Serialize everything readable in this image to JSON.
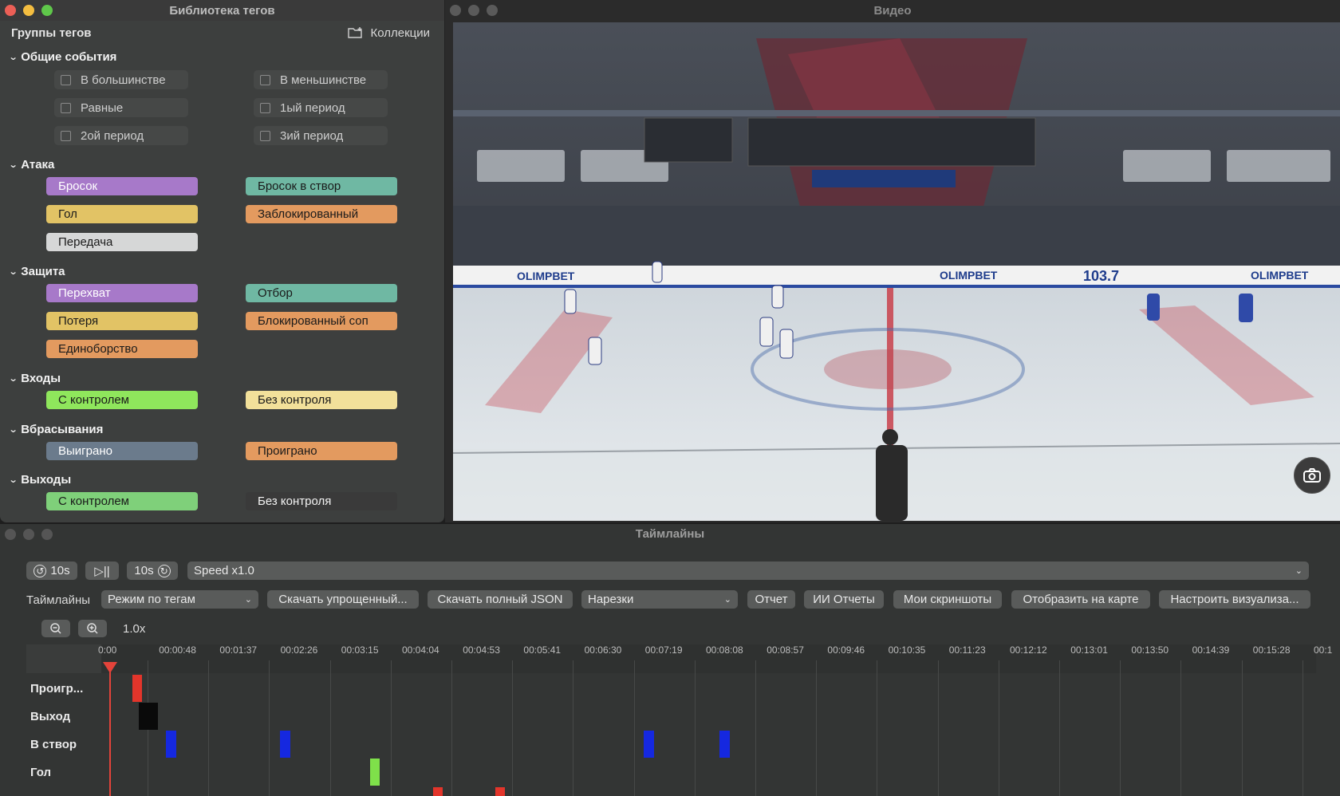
{
  "tag_library": {
    "window_title": "Библиотека тегов",
    "groups_label": "Группы тегов",
    "collections_label": "Коллекции",
    "sections": {
      "general": {
        "title": "Общие события",
        "checkboxes": [
          "В большинстве",
          "В меньшинстве",
          "Равные",
          "1ый период",
          "2ой период",
          "3ий период"
        ]
      },
      "attack": {
        "title": "Атака",
        "tags": [
          {
            "label": "Бросок",
            "color": "#a779c9"
          },
          {
            "label": "Бросок в створ",
            "color": "#6fb8a3"
          },
          {
            "label": "Гол",
            "color": "#e2c365"
          },
          {
            "label": "Заблокированный",
            "color": "#e39a5f"
          },
          {
            "label": "Передача",
            "color": "#d6d7d7"
          }
        ]
      },
      "defense": {
        "title": "Защита",
        "tags": [
          {
            "label": "Перехват",
            "color": "#a779c9"
          },
          {
            "label": "Отбор",
            "color": "#6fb8a3"
          },
          {
            "label": "Потеря",
            "color": "#e2c365"
          },
          {
            "label": "Блокированный соп",
            "color": "#e39a5f"
          },
          {
            "label": "Единоборство",
            "color": "#e39a5f"
          }
        ]
      },
      "entries": {
        "title": "Входы",
        "tags": [
          {
            "label": "С контролем",
            "color": "#8fe65c"
          },
          {
            "label": "Без контроля",
            "color": "#f2e09a"
          }
        ]
      },
      "faceoffs": {
        "title": "Вбрасывания",
        "tags": [
          {
            "label": "Выиграно",
            "color": "#6b7b8c"
          },
          {
            "label": "Проиграно",
            "color": "#e39a5f"
          }
        ]
      },
      "exits": {
        "title": "Выходы",
        "tags": [
          {
            "label": "С контролем",
            "color": "#7fd07a"
          },
          {
            "label": "Без контроля",
            "color": "#3a3a3a"
          }
        ]
      }
    }
  },
  "video": {
    "window_title": "Видео",
    "scoreboard_text": "103.7",
    "board_ads": [
      "OLIMPBET",
      "OLIMPBET",
      "OLIMPBET"
    ]
  },
  "timelines": {
    "window_title": "Таймлайны",
    "rewind_label": "10s",
    "forward_label": "10s",
    "play_pause_label": "▷||",
    "speed_label": "Speed x1.0",
    "timelines_label": "Таймлайны",
    "mode_select": "Режим по тегам",
    "buttons": [
      "Скачать упрощенный...",
      "Скачать полный JSON",
      "Отчет",
      "ИИ Отчеты",
      "Мои скриншоты",
      "Отобразить на карте",
      "Настроить визуализа..."
    ],
    "cuts_select": "Нарезки",
    "zoom_level": "1.0x",
    "ruler_ticks": [
      "0:00",
      "00:00:48",
      "00:01:37",
      "00:02:26",
      "00:03:15",
      "00:04:04",
      "00:04:53",
      "00:05:41",
      "00:06:30",
      "00:07:19",
      "00:08:08",
      "00:08:57",
      "00:09:46",
      "00:10:35",
      "00:11:23",
      "00:12:12",
      "00:13:01",
      "00:13:50",
      "00:14:39",
      "00:15:28",
      "00:1"
    ],
    "rows": [
      "Проигр...",
      "Выход",
      "В створ",
      "Гол"
    ]
  }
}
